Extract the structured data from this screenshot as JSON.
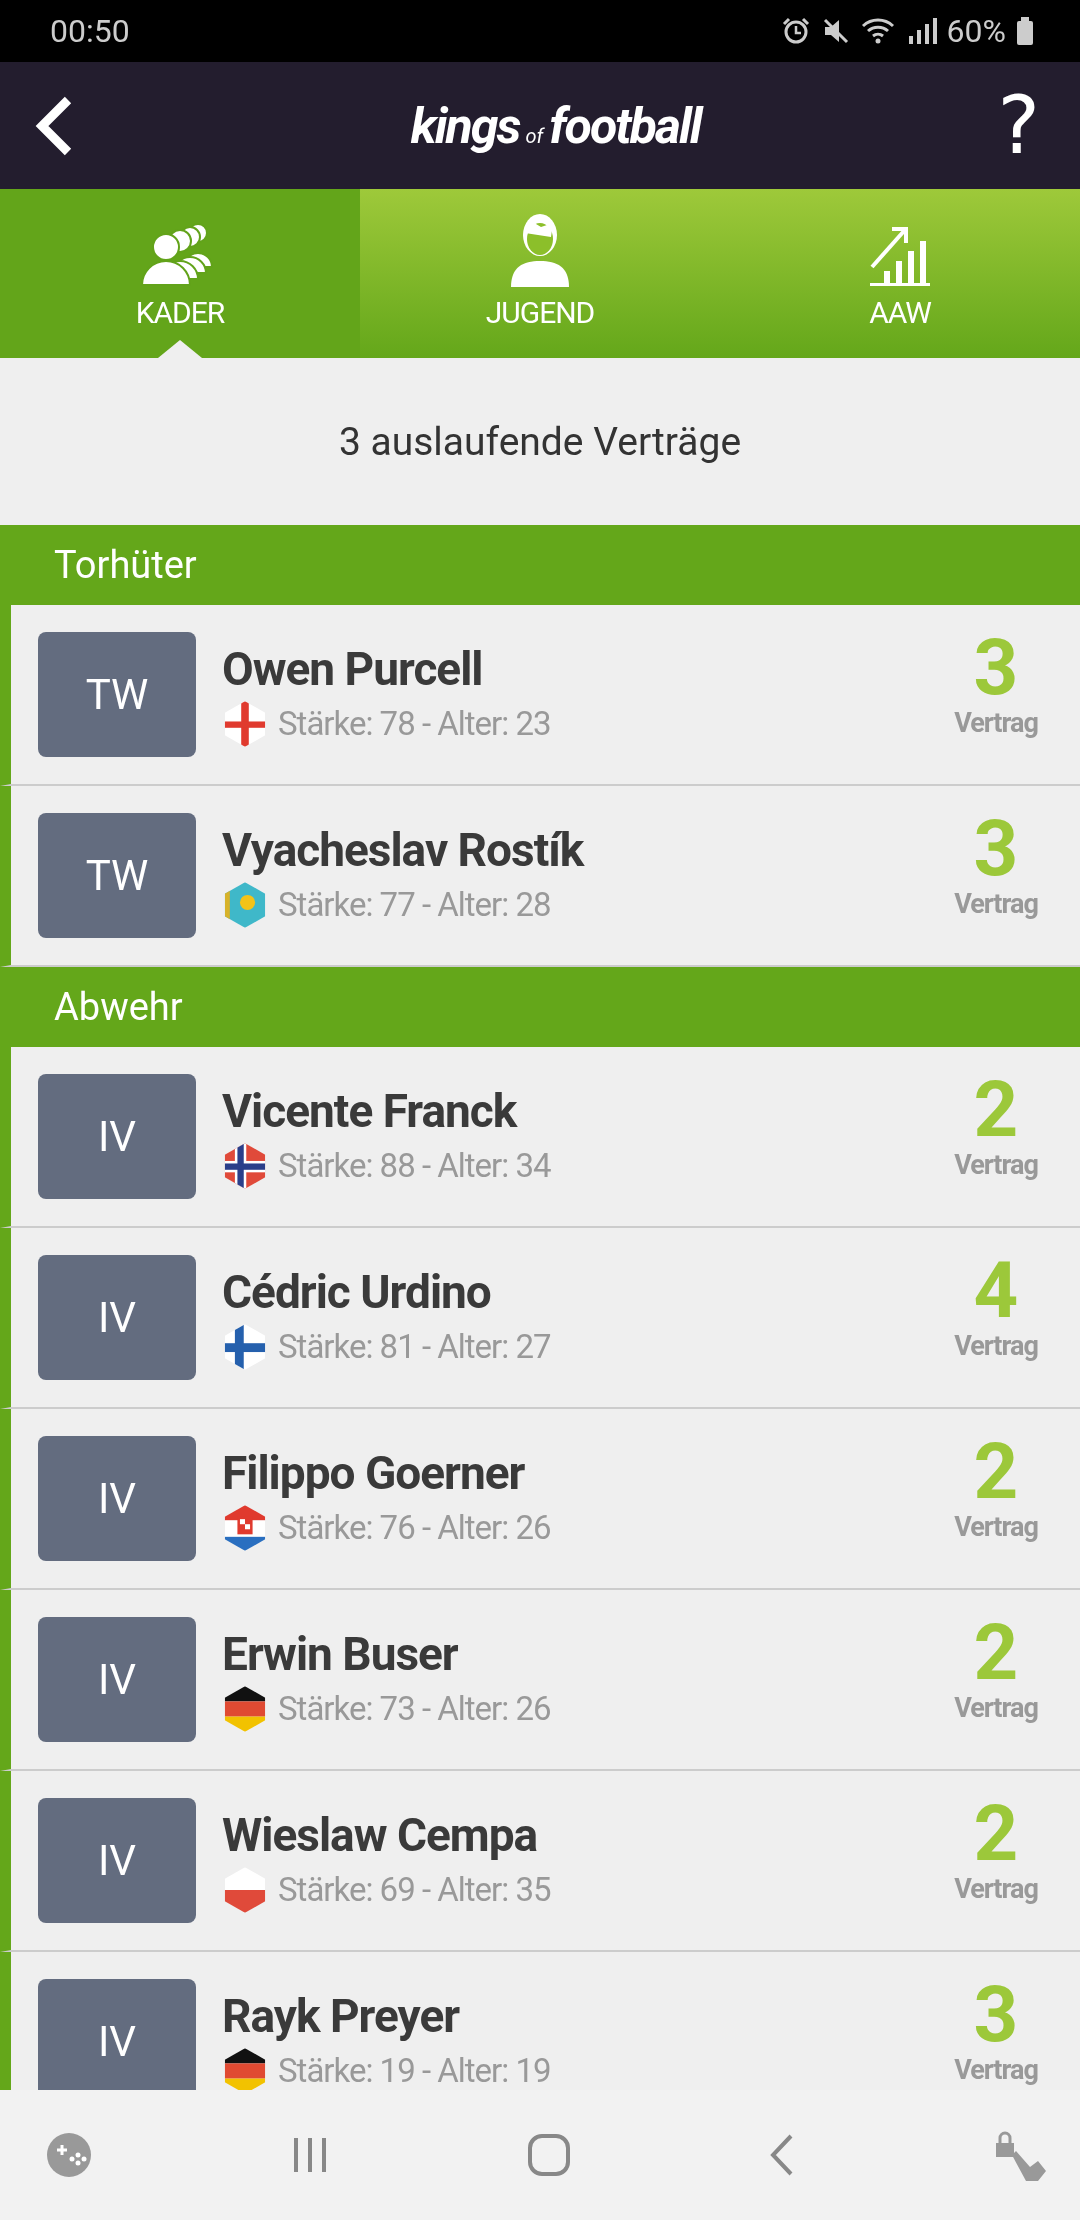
{
  "status_bar": {
    "time": "00:50",
    "battery": "60%"
  },
  "header": {
    "logo_main": "kings",
    "logo_small": "of",
    "logo_end": "football",
    "help": "?"
  },
  "tabs": [
    {
      "label": "KADER",
      "kind": "group",
      "selected": true
    },
    {
      "label": "JUGEND",
      "kind": "person",
      "selected": false
    },
    {
      "label": "AAW",
      "kind": "chart",
      "selected": false
    }
  ],
  "subtitle": "3 auslaufende Verträge",
  "sections": [
    {
      "title": "Torhüter",
      "players": [
        {
          "position": "TW",
          "name": "Owen Purcell",
          "kind": "nir",
          "stats": "Stärke: 78 - Alter: 23",
          "contract": "3",
          "contract_label": "Vertrag"
        },
        {
          "position": "TW",
          "name": "Vyacheslav Rostík",
          "kind": "kaz",
          "stats": "Stärke: 77 - Alter: 28",
          "contract": "3",
          "contract_label": "Vertrag"
        }
      ]
    },
    {
      "title": "Abwehr",
      "players": [
        {
          "position": "IV",
          "name": "Vicente Franck",
          "kind": "nor",
          "stats": "Stärke: 88 - Alter: 34",
          "contract": "2",
          "contract_label": "Vertrag"
        },
        {
          "position": "IV",
          "name": "Cédric Urdino",
          "kind": "fin",
          "stats": "Stärke: 81 - Alter: 27",
          "contract": "4",
          "contract_label": "Vertrag"
        },
        {
          "position": "IV",
          "name": "Filippo Goerner",
          "kind": "cro",
          "stats": "Stärke: 76 - Alter: 26",
          "contract": "2",
          "contract_label": "Vertrag"
        },
        {
          "position": "IV",
          "name": "Erwin Buser",
          "kind": "ger",
          "stats": "Stärke: 73 - Alter: 26",
          "contract": "2",
          "contract_label": "Vertrag"
        },
        {
          "position": "IV",
          "name": "Wieslaw Cempa",
          "kind": "pol",
          "stats": "Stärke: 69 - Alter: 35",
          "contract": "2",
          "contract_label": "Vertrag"
        },
        {
          "position": "IV",
          "name": "Rayk Preyer",
          "kind": "ger",
          "stats": "Stärke: 19 - Alter: 19",
          "contract": "3",
          "contract_label": "Vertrag"
        }
      ]
    }
  ]
}
